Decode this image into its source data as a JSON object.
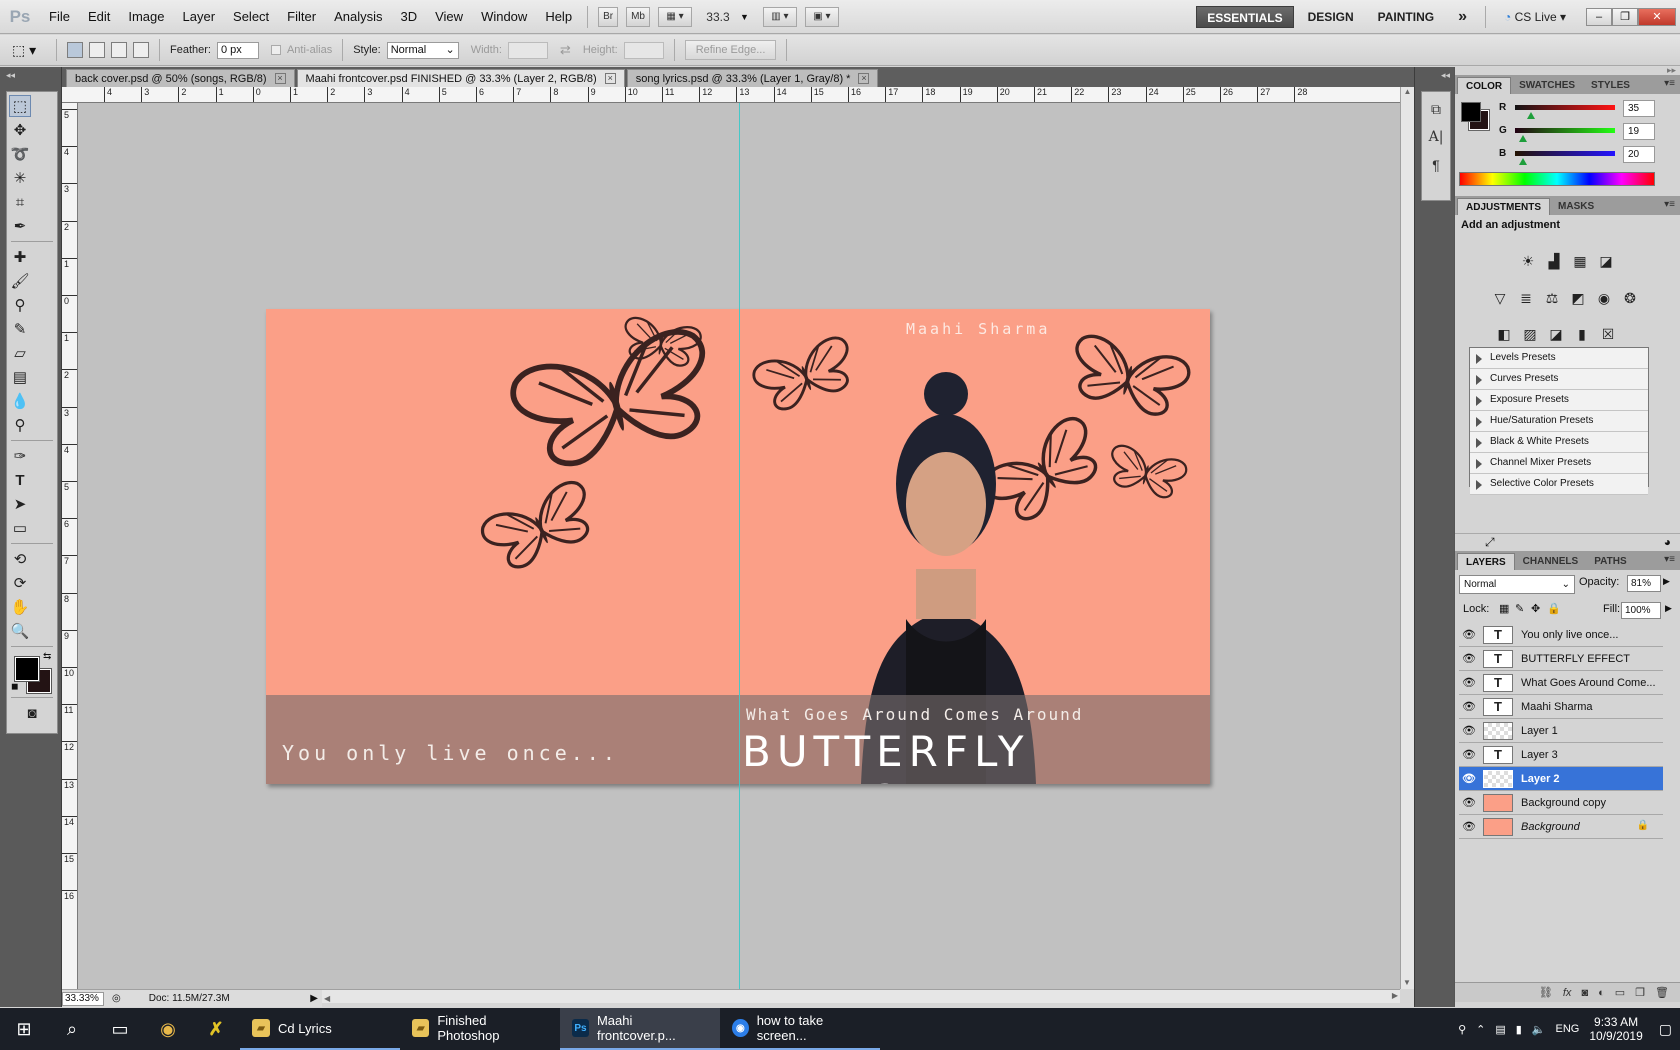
{
  "menubar": {
    "logo": "Ps",
    "items": [
      "File",
      "Edit",
      "Image",
      "Layer",
      "Select",
      "Filter",
      "Analysis",
      "3D",
      "View",
      "Window",
      "Help"
    ],
    "bridge": "Br",
    "minibridge": "Mb",
    "zoom": "33.3",
    "workspaces": [
      "ESSENTIALS",
      "DESIGN",
      "PAINTING"
    ],
    "more": "»",
    "cslive": "CS Live"
  },
  "options": {
    "feather_label": "Feather:",
    "feather_value": "0 px",
    "antialias_label": "Anti-alias",
    "style_label": "Style:",
    "style_value": "Normal",
    "width_label": "Width:",
    "height_label": "Height:",
    "refine_edge": "Refine Edge..."
  },
  "doc_tabs": [
    {
      "label": "back cover.psd @ 50% (songs, RGB/8)",
      "active": false
    },
    {
      "label": "Maahi frontcover.psd FINISHED @ 33.3% (Layer 2, RGB/8)",
      "active": true
    },
    {
      "label": "song lyrics.psd @ 33.3% (Layer 1, Gray/8) *",
      "active": false
    }
  ],
  "rulers": {
    "top": [
      "4",
      "3",
      "2",
      "1",
      "0",
      "1",
      "2",
      "3",
      "4",
      "5",
      "6",
      "7",
      "8",
      "9",
      "10",
      "11",
      "12",
      "13",
      "14",
      "15",
      "16",
      "17",
      "18",
      "19",
      "20",
      "21",
      "22",
      "23",
      "24",
      "25",
      "26",
      "27",
      "28"
    ],
    "left": [
      "5",
      "4",
      "3",
      "2",
      "1",
      "0",
      "1",
      "2",
      "3",
      "4",
      "5",
      "6",
      "7",
      "8",
      "9",
      "10",
      "11",
      "12",
      "13",
      "14",
      "15",
      "16"
    ]
  },
  "artwork": {
    "artist": "Maahi Sharma",
    "tagline_top": "What Goes Around Comes Around",
    "title": "BUTTERFLY EFFECT",
    "back_tagline": "You only live once...",
    "background_color": "#fb9f87"
  },
  "status": {
    "zoom": "33.33%",
    "doc": "Doc: 11.5M/27.3M"
  },
  "color_panel": {
    "tabs": [
      "COLOR",
      "SWATCHES",
      "STYLES"
    ],
    "r": "35",
    "g": "19",
    "b": "20",
    "r_label": "R",
    "g_label": "G",
    "b_label": "B",
    "foreground": "#231314"
  },
  "adjustments": {
    "tabs": [
      "ADJUSTMENTS",
      "MASKS"
    ],
    "title": "Add an adjustment",
    "presets": [
      "Levels Presets",
      "Curves Presets",
      "Exposure Presets",
      "Hue/Saturation Presets",
      "Black & White Presets",
      "Channel Mixer Presets",
      "Selective Color Presets"
    ]
  },
  "layers_panel": {
    "tabs": [
      "LAYERS",
      "CHANNELS",
      "PATHS"
    ],
    "blend_mode": "Normal",
    "opacity_label": "Opacity:",
    "opacity": "81%",
    "lock_label": "Lock:",
    "fill_label": "Fill:",
    "fill": "100%",
    "layers": [
      {
        "name": "You only live once...",
        "type": "text"
      },
      {
        "name": "BUTTERFLY EFFECT",
        "type": "text"
      },
      {
        "name": "What Goes Around Come...",
        "type": "text"
      },
      {
        "name": "Maahi Sharma",
        "type": "text"
      },
      {
        "name": "Layer 1",
        "type": "pixel"
      },
      {
        "name": "Layer 3",
        "type": "text"
      },
      {
        "name": "Layer 2",
        "type": "pixel",
        "selected": true
      },
      {
        "name": "Background copy",
        "type": "image"
      },
      {
        "name": "Background",
        "type": "background"
      }
    ]
  },
  "taskbar": {
    "apps": [
      {
        "label": "Cd Lyrics",
        "icon": "folder-icon"
      },
      {
        "label": "Finished Photoshop",
        "icon": "folder-icon"
      },
      {
        "label": "Maahi frontcover.p...",
        "icon": "photoshop-icon"
      },
      {
        "label": "how to take screen...",
        "icon": "chrome-icon"
      }
    ],
    "lang": "ENG",
    "time": "9:33 AM",
    "date": "10/9/2019"
  }
}
